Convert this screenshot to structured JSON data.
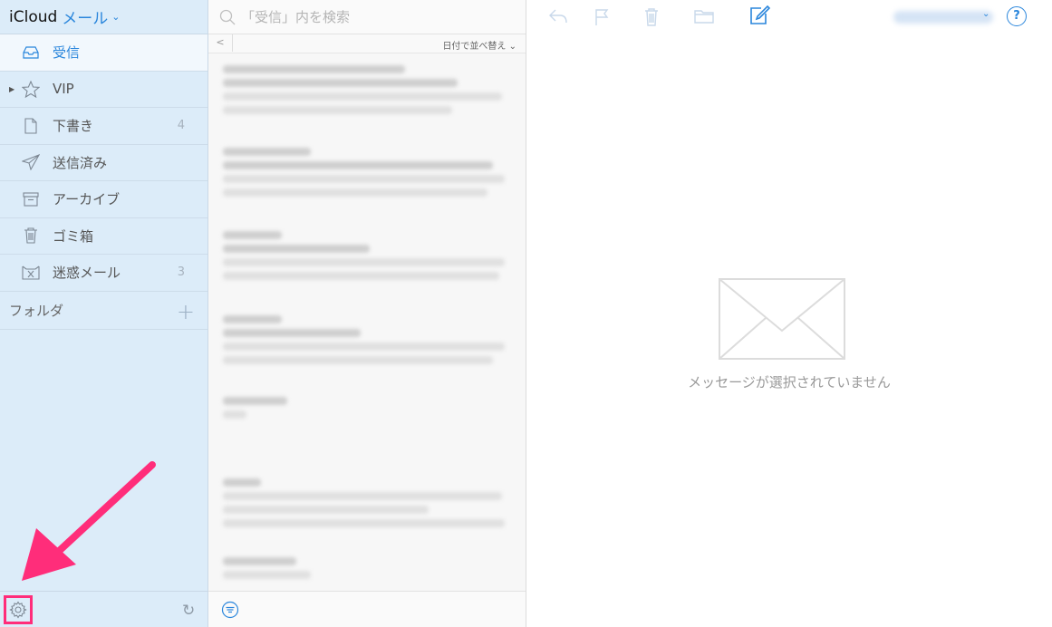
{
  "header": {
    "brand": "iCloud",
    "app_name": "メール"
  },
  "sidebar": {
    "mailboxes": [
      {
        "label": "受信",
        "count": "",
        "icon": "inbox-icon",
        "active": true
      },
      {
        "label": "VIP",
        "count": "",
        "icon": "star-icon"
      },
      {
        "label": "下書き",
        "count": "4",
        "icon": "draft-icon"
      },
      {
        "label": "送信済み",
        "count": "",
        "icon": "sent-icon"
      },
      {
        "label": "アーカイブ",
        "count": "",
        "icon": "archive-icon"
      },
      {
        "label": "ゴミ箱",
        "count": "",
        "icon": "trash-icon"
      },
      {
        "label": "迷惑メール",
        "count": "3",
        "icon": "junk-icon"
      }
    ],
    "folders_label": "フォルダ"
  },
  "list": {
    "search_placeholder": "「受信」内を検索",
    "sort_label": "日付で並べ替え"
  },
  "reader": {
    "empty_text": "メッセージが選択されていません"
  },
  "colors": {
    "accent": "#2a86dc",
    "sidebar_bg": "#dcecf9",
    "highlight": "#ff2d7a"
  }
}
